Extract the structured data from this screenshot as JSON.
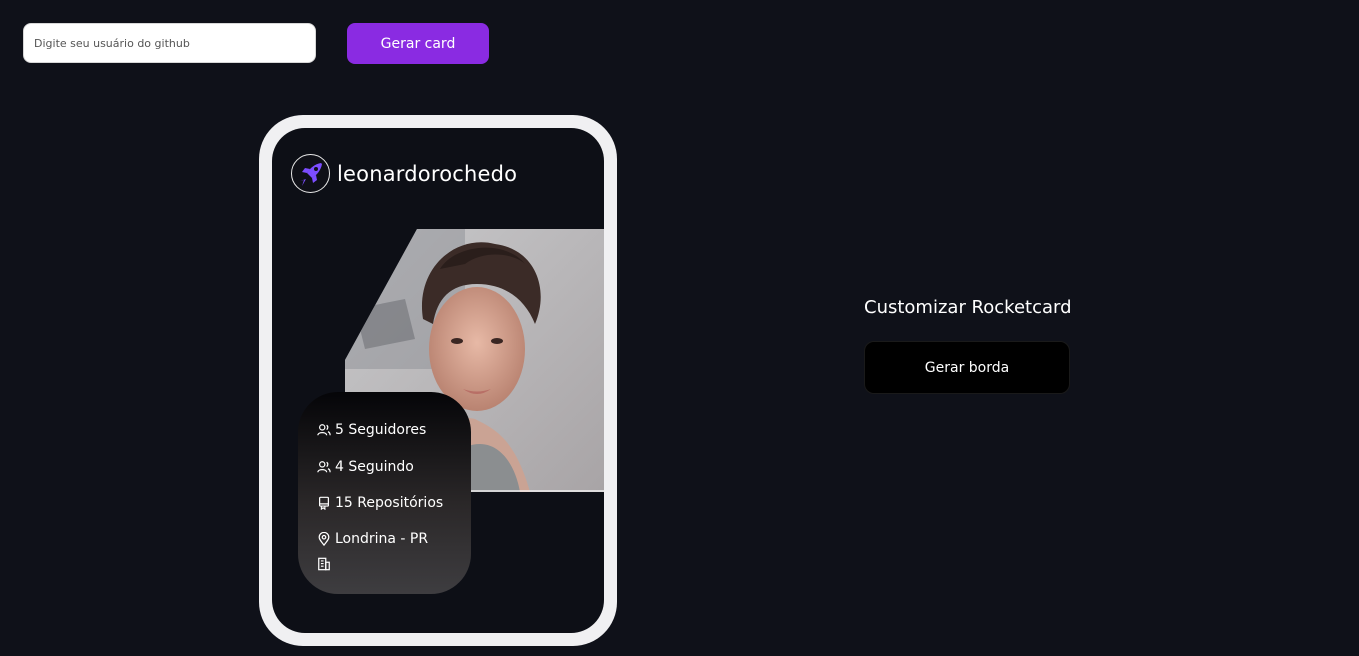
{
  "search": {
    "placeholder": "Digite seu usuário do github",
    "value": ""
  },
  "toolbar": {
    "generate_card_label": "Gerar card",
    "accent_color": "#8a2be2"
  },
  "card": {
    "username": "leonardorochedo",
    "avatar_icon": "rocket-icon",
    "photo_alt": "profile-photo",
    "stats": {
      "followers": "5 Seguidores",
      "following": "4 Seguindo",
      "repositories": "15 Repositórios",
      "location": "Londrina - PR",
      "company": ""
    },
    "stat_icons": {
      "followers": "users-icon",
      "following": "users-icon",
      "repositories": "repo-icon",
      "location": "map-pin-icon",
      "company": "building-icon"
    },
    "frame_color": "#f0f0f2",
    "background_color": "#0d0f16"
  },
  "customize": {
    "title": "Customizar Rocketcard",
    "generate_border_label": "Gerar borda"
  }
}
